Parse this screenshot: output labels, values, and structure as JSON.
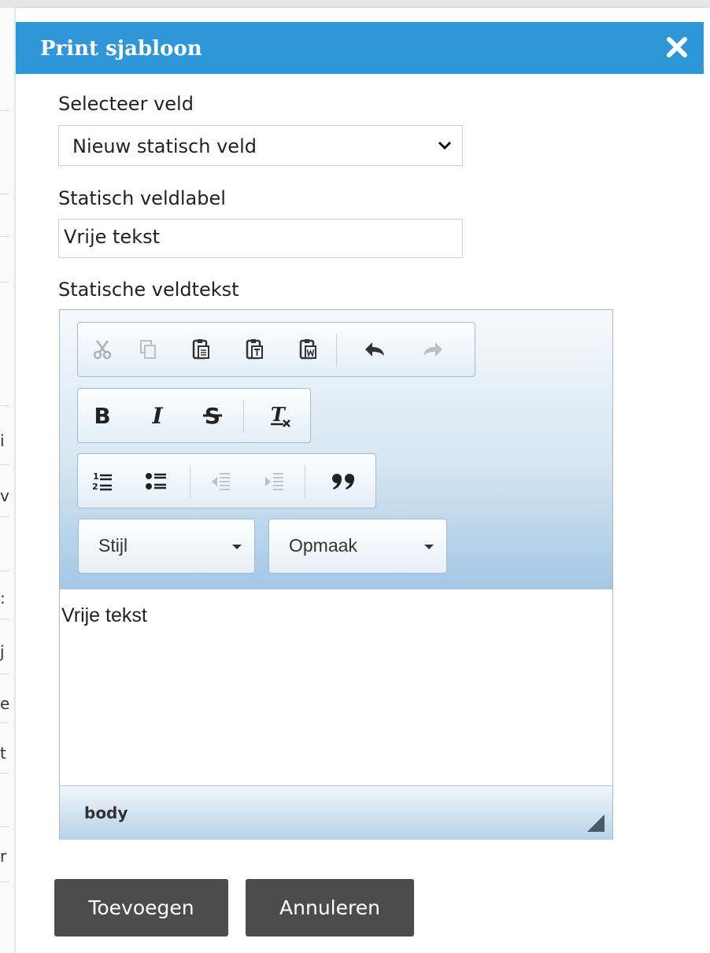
{
  "dialog": {
    "title": "Print sjabloon",
    "close_icon": "close-icon"
  },
  "form": {
    "select_field_label": "Selecteer veld",
    "select_field_value": "Nieuw statisch veld",
    "static_label_label": "Statisch veldlabel",
    "static_label_value": "Vrije tekst",
    "static_text_label": "Statische veldtekst"
  },
  "editor": {
    "toolbar_groups": [
      [
        "cut-icon",
        "copy-icon",
        "paste-icon",
        "paste-text-icon",
        "paste-word-icon",
        "undo-icon",
        "redo-icon"
      ],
      [
        "bold-icon",
        "italic-icon",
        "strikethrough-icon",
        "remove-format-icon"
      ],
      [
        "numbered-list-icon",
        "bulleted-list-icon",
        "outdent-icon",
        "indent-icon",
        "blockquote-icon"
      ]
    ],
    "style_combo": "Stijl",
    "format_combo": "Opmaak",
    "content": "Vrije tekst",
    "path": "body"
  },
  "buttons": {
    "add": "Toevoegen",
    "cancel": "Annuleren"
  },
  "colors": {
    "title_bar": "#2f97d8",
    "action_button": "#4c4c4c"
  }
}
